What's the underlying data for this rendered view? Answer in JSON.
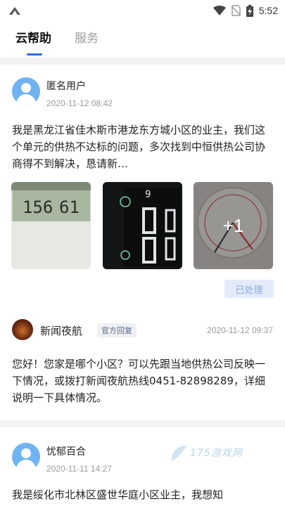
{
  "status_bar": {
    "time": "5:52"
  },
  "tabs": [
    {
      "label": "云帮助",
      "active": true
    },
    {
      "label": "服务",
      "active": false
    }
  ],
  "posts": [
    {
      "user": "匿名用户",
      "time": "2020-11-12 08:42",
      "content": "我是黑龙江省佳木斯市港龙东方城小区的业主，我们这个单元的供热不达标的问题，多次找到中恒供热公司协商得不到解决，恳请新…",
      "more_images": "+1",
      "status": "已处理",
      "reply": {
        "name": "新闻夜航",
        "tag": "官方回复",
        "time": "2020-11-12 09:37",
        "content": "您好！您家是哪个小区？可以先跟当地供热公司反映一下情况，或拨打新闻夜航热线0451-82898289，详细说明一下具体情况。"
      }
    },
    {
      "user": "忧郁百合",
      "time": "2020-11-11 14:27",
      "content": "我是绥化市北林区盛世华庭小区业主，我想知"
    }
  ],
  "watermark": "175游戏网",
  "colors": {
    "accent": "#2c6be0",
    "badge_bg": "#e3ebfb",
    "avatar": "#6fb3f2"
  }
}
